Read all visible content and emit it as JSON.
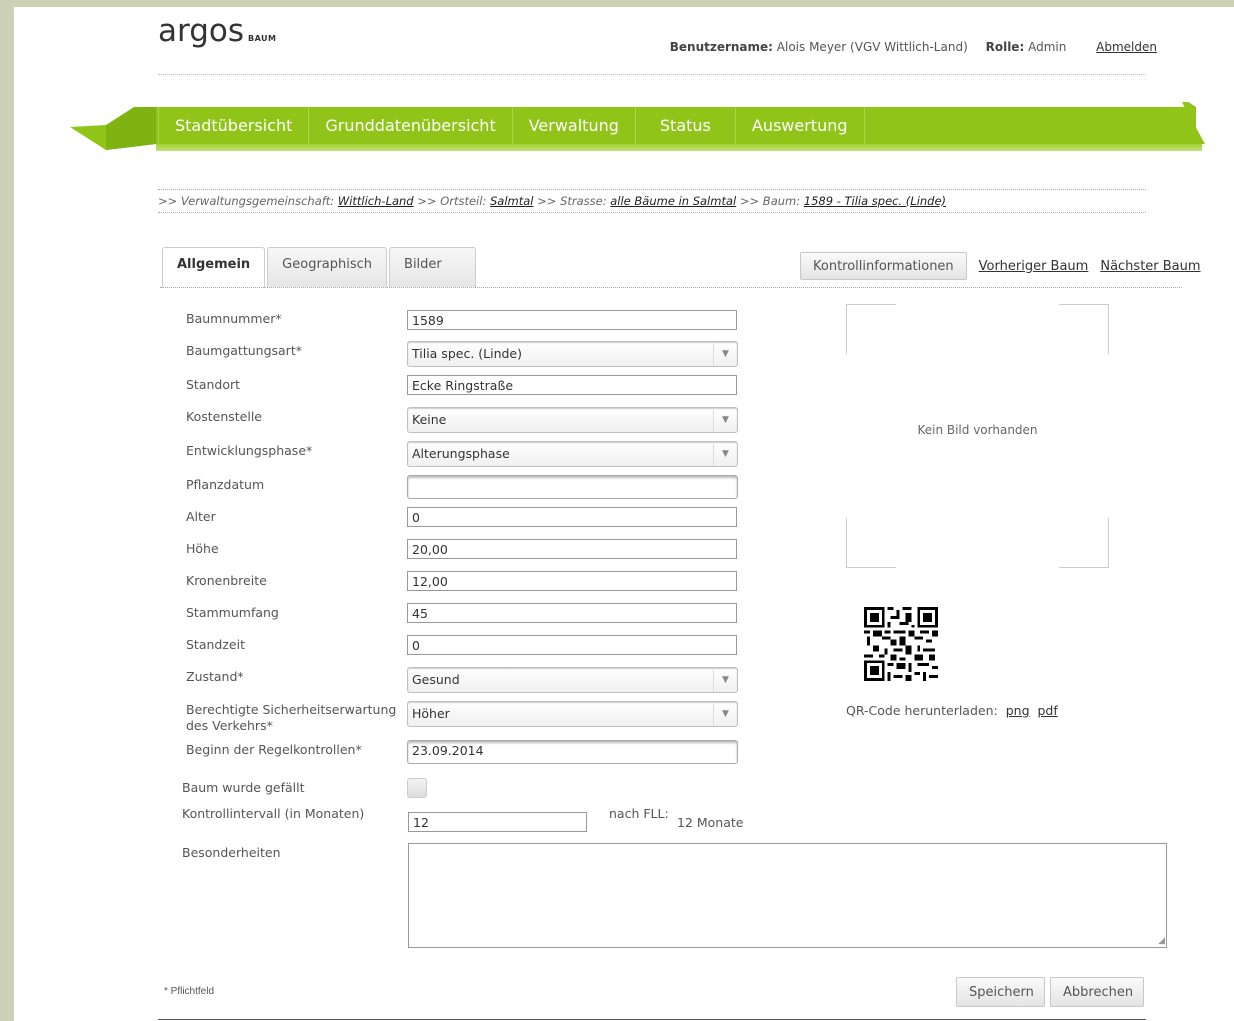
{
  "header": {
    "logo_main": "argos",
    "logo_sub": "BAUM",
    "username_label": "Benutzername:",
    "username_value": "Alois Meyer (VGV Wittlich-Land)",
    "role_label": "Rolle:",
    "role_value": "Admin",
    "logout": "Abmelden"
  },
  "nav": {
    "items": [
      "Stadtübersicht",
      "Grunddatenübersicht",
      "Verwaltung",
      "Status",
      "Auswertung"
    ]
  },
  "breadcrumb": {
    "p1": ">> Verwaltungsgemeinschaft: ",
    "l1": "Wittlich-Land",
    "p2": " >> Ortsteil: ",
    "l2": "Salmtal",
    "p3": " >> Strasse: ",
    "l3": "alle Bäume in Salmtal",
    "p4": " >> Baum: ",
    "l4": "1589 - Tilia spec. (Linde)"
  },
  "tabs": [
    "Allgemein",
    "Geographisch",
    "Bilder"
  ],
  "actions": {
    "kontroll": "Kontrollinformationen",
    "prev": "Vorheriger Baum",
    "next": "Nächster Baum"
  },
  "form": {
    "baumnummer": {
      "label": "Baumnummer*",
      "value": "1589"
    },
    "baumgattungsart": {
      "label": "Baumgattungsart*",
      "value": "Tilia spec. (Linde)"
    },
    "standort": {
      "label": "Standort",
      "value": "Ecke Ringstraße"
    },
    "kostenstelle": {
      "label": "Kostenstelle",
      "value": "Keine"
    },
    "entwicklungsphase": {
      "label": "Entwicklungsphase*",
      "value": "Alterungsphase"
    },
    "pflanzdatum": {
      "label": "Pflanzdatum",
      "value": ""
    },
    "alter": {
      "label": "Alter",
      "value": "0"
    },
    "hoehe": {
      "label": "Höhe",
      "value": "20,00"
    },
    "kronenbreite": {
      "label": "Kronenbreite",
      "value": "12,00"
    },
    "stammumfang": {
      "label": "Stammumfang",
      "value": "45"
    },
    "standzeit": {
      "label": "Standzeit",
      "value": "0"
    },
    "zustand": {
      "label": "Zustand*",
      "value": "Gesund"
    },
    "sicherheit": {
      "label1": "Berechtigte Sicherheitserwartung",
      "label2": "des Verkehrs*",
      "value": "Höher"
    },
    "regelkontrollen": {
      "label": "Beginn der Regelkontrollen*",
      "value": "23.09.2014"
    },
    "gefaellt": {
      "label": "Baum wurde gefällt"
    },
    "kontrollintervall": {
      "label": "Kontrollintervall (in Monaten)",
      "value": "12",
      "fll_label": "nach FLL:",
      "fll_value": "12 Monate"
    },
    "besonderheiten": {
      "label": "Besonderheiten",
      "value": ""
    }
  },
  "image": {
    "placeholder": "Kein Bild vorhanden"
  },
  "qr": {
    "label": "QR-Code herunterladen:",
    "png": "png",
    "pdf": "pdf"
  },
  "footer": {
    "required_note": "* Pflichtfeld",
    "save": "Speichern",
    "cancel": "Abbrechen"
  },
  "colors": {
    "nav_green": "#90c418",
    "background": "#ccd0b4"
  }
}
